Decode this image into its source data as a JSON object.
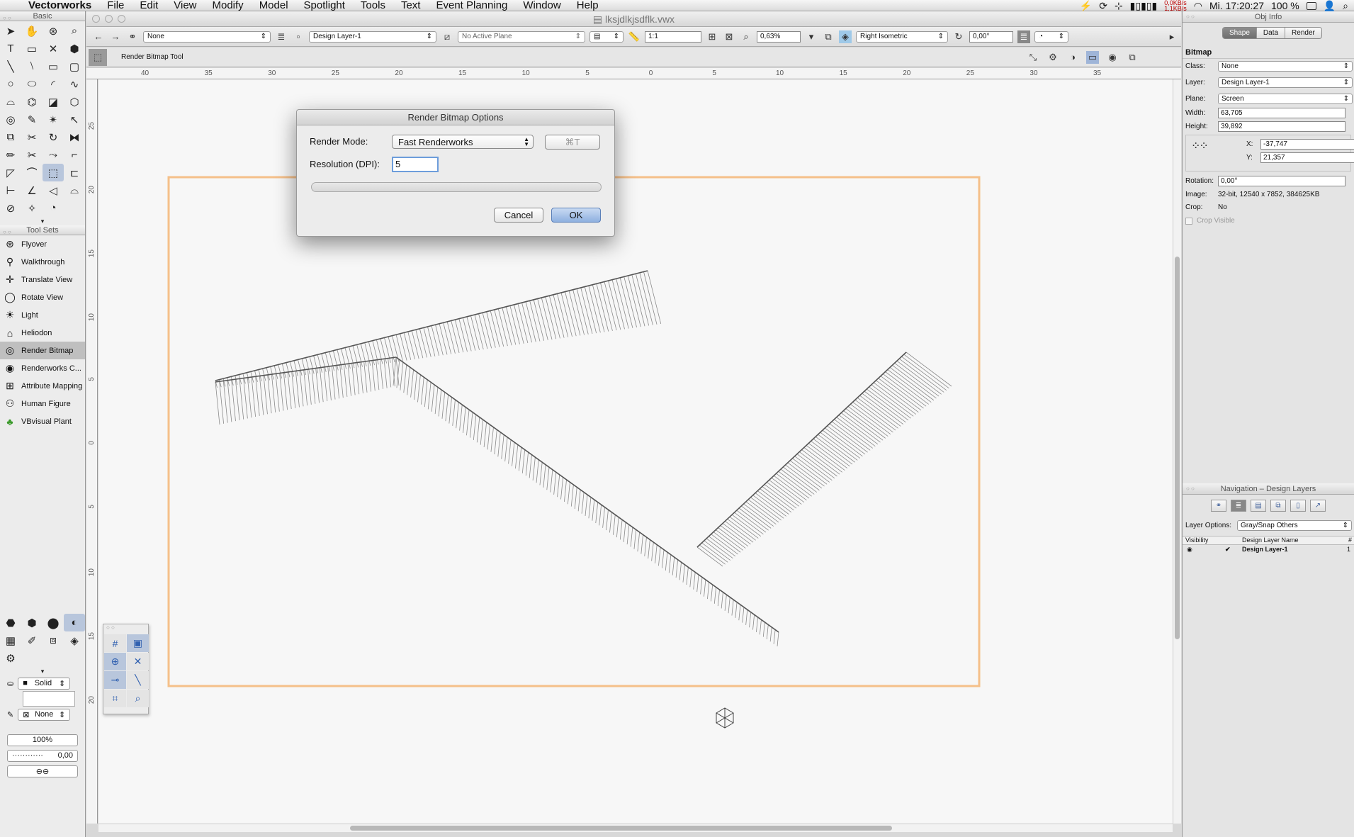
{
  "menubar": {
    "app_name": "Vectorworks",
    "menus": [
      "File",
      "Edit",
      "View",
      "Modify",
      "Model",
      "Spotlight",
      "Tools",
      "Text",
      "Event Planning",
      "Window",
      "Help"
    ],
    "network_tx": "0,0KB/s",
    "network_rx": "1,1KB/s",
    "clock": "Mi. 17:20:27",
    "battery": "100 %"
  },
  "document": {
    "title": "lksjdlkjsdflk.vwx"
  },
  "left_palette": {
    "basic_title": "Basic",
    "toolsets_title": "Tool Sets",
    "toolsets": [
      {
        "label": "Flyover",
        "icon": "flyover-icon",
        "selected": false
      },
      {
        "label": "Walkthrough",
        "icon": "walkthrough-icon",
        "selected": false
      },
      {
        "label": "Translate View",
        "icon": "translate-view-icon",
        "selected": false
      },
      {
        "label": "Rotate View",
        "icon": "rotate-view-icon",
        "selected": false
      },
      {
        "label": "Light",
        "icon": "light-icon",
        "selected": false
      },
      {
        "label": "Heliodon",
        "icon": "heliodon-icon",
        "selected": false
      },
      {
        "label": "Render Bitmap",
        "icon": "render-bitmap-icon",
        "selected": true
      },
      {
        "label": "Renderworks C...",
        "icon": "renderworks-camera-icon",
        "selected": false
      },
      {
        "label": "Attribute Mapping",
        "icon": "attribute-mapping-icon",
        "selected": false
      },
      {
        "label": "Human Figure",
        "icon": "human-figure-icon",
        "selected": false
      },
      {
        "label": "VBvisual Plant",
        "icon": "plant-icon",
        "selected": false
      }
    ],
    "fill_style": "Solid",
    "pen_style": "None",
    "opacity": "100%",
    "line_weight": "0,00"
  },
  "toolbar": {
    "class_value": "None",
    "layer_value": "Design Layer-1",
    "plane_value": "No Active Plane",
    "scale_value": "1:1",
    "zoom_value": "0,63%",
    "view_value": "Right Isometric",
    "rotation_value": "0,00°",
    "mode_bar_label": "Render Bitmap Tool"
  },
  "ruler": {
    "h_ticks": [
      "40",
      "35",
      "30",
      "25",
      "20",
      "15",
      "10",
      "5",
      "0",
      "5",
      "10",
      "15",
      "20",
      "25",
      "30",
      "35"
    ],
    "v_ticks": [
      "25",
      "20",
      "15",
      "10",
      "5",
      "0",
      "5",
      "10",
      "15",
      "20"
    ]
  },
  "dialog": {
    "title": "Render Bitmap Options",
    "render_mode_label": "Render Mode:",
    "render_mode_value": "Fast Renderworks",
    "shortcut_label": "⌘T",
    "resolution_label": "Resolution (DPI):",
    "resolution_value": "5",
    "cancel_label": "Cancel",
    "ok_label": "OK"
  },
  "obj_info": {
    "title": "Obj Info",
    "tabs": [
      "Shape",
      "Data",
      "Render"
    ],
    "active_tab": "Shape",
    "object_type": "Bitmap",
    "class_label": "Class:",
    "class_value": "None",
    "layer_label": "Layer:",
    "layer_value": "Design Layer-1",
    "plane_label": "Plane:",
    "plane_value": "Screen",
    "width_label": "Width:",
    "width_value": "63,705",
    "height_label": "Height:",
    "height_value": "39,892",
    "x_label": "X:",
    "x_value": "-37,747",
    "y_label": "Y:",
    "y_value": "21,357",
    "rotation_label": "Rotation:",
    "rotation_value": "0,00°",
    "image_label": "Image:",
    "image_value": "32-bit, 12540 x 7852, 384625KB",
    "crop_label": "Crop:",
    "crop_value": "No",
    "crop_visible_label": "Crop Visible"
  },
  "navigation": {
    "title": "Navigation – Design Layers",
    "layer_options_label": "Layer Options:",
    "layer_options_value": "Gray/Snap Others",
    "col_visibility": "Visibility",
    "col_layer_name": "Design Layer Name",
    "col_num": "#",
    "layers": [
      {
        "name": "Design Layer-1",
        "num": "1"
      }
    ]
  },
  "colors": {
    "page_border": "#f5c08a",
    "accent": "#6d9ddb",
    "selection": "#b8c6dc"
  }
}
